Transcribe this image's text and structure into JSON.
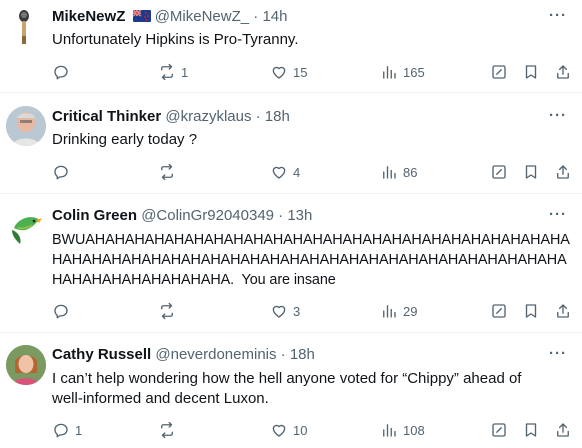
{
  "tweets": [
    {
      "name": "MikeNewZ",
      "handle": "@MikeNewZ_",
      "time": "· 14h",
      "text": "Unfortunately Hipkins is Pro-Tyranny.",
      "replies": "",
      "retweets": "1",
      "likes": "15",
      "views": "165",
      "avatar": "mic-avatar",
      "has_flag": true
    },
    {
      "name": "Critical Thinker",
      "handle": "@krazyklaus",
      "time": "· 18h",
      "text": "Drinking early today ?",
      "replies": "",
      "retweets": "",
      "likes": "4",
      "views": "86",
      "avatar": "man-avatar"
    },
    {
      "name": "Colin Green",
      "handle": "@ColinGr92040349",
      "time": "· 13h",
      "text": "BWUAHAHAHAHAHAHAHAHAHAHAHAHAHAHAHAHAHAHAHAHAHAHAHAHA\nHAHAHAHAHAHAHAHAHAHAHAHAHAHAHAHAHAHAHAHAHAHAHAHAHAHA\nHAHAHAHAHAHAHAHAHA.  You are insane",
      "replies": "",
      "retweets": "",
      "likes": "3",
      "views": "29",
      "avatar": "parrot-avatar"
    },
    {
      "name": "Cathy Russell",
      "handle": "@neverdoneminis",
      "time": "· 18h",
      "text": "I can’t help wondering how the hell anyone voted for “Chippy” ahead of\nwell-informed and decent Luxon.",
      "replies": "1",
      "retweets": "",
      "likes": "10",
      "views": "108",
      "avatar": "woman-avatar"
    }
  ],
  "more_label": "···",
  "colors": {
    "text": "#0f1419",
    "muted": "#536471",
    "divider": "#eff3f4"
  }
}
